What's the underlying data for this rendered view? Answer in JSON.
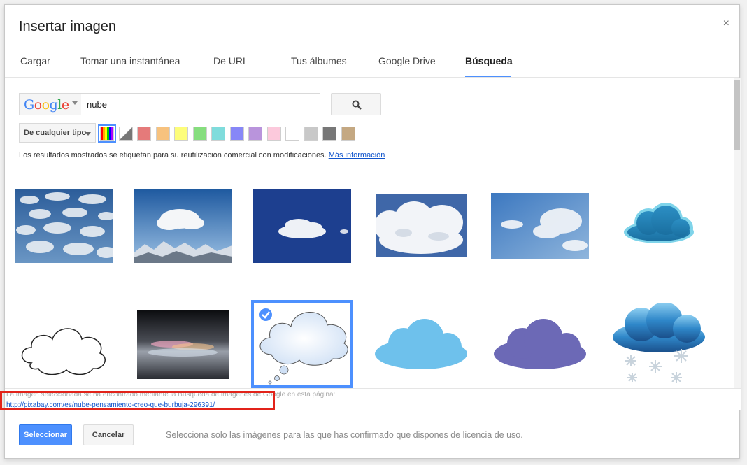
{
  "dialog": {
    "title": "Insertar imagen",
    "close_symbol": "×"
  },
  "tabs": [
    {
      "label": "Cargar",
      "active": false
    },
    {
      "label": "Tomar una instantánea",
      "active": false
    },
    {
      "label": "De URL",
      "active": false
    },
    {
      "label": "Tus álbumes",
      "active": false
    },
    {
      "label": "Google Drive",
      "active": false
    },
    {
      "label": "Búsqueda",
      "active": true
    }
  ],
  "search": {
    "engine_label": "Google",
    "query": "nube",
    "button_icon": "search-icon"
  },
  "filters": {
    "type_label": "De cualquier tipo",
    "colors": [
      "multicolor",
      "transparent",
      "#e57a7a",
      "#f7c27e",
      "#fdfd7a",
      "#86de7e",
      "#7fdcdc",
      "#8787f7",
      "#b994dc",
      "#fcc9dc",
      "#ffffff",
      "#c8c8c8",
      "#777777",
      "#c4a882"
    ],
    "selected_color_index": 0
  },
  "license": {
    "text": "Los resultados mostrados se etiquetan para su reutilización comercial con modificaciones.",
    "link": "Más información"
  },
  "results": {
    "selected_index": 8
  },
  "source": {
    "caption": "La imagen seleccionada se ha encontrado mediante la Búsqueda de imágenes de Google en esta página:",
    "url": "http://pixabay.com/es/nube-pensamiento-creo-que-burbuja-296391/"
  },
  "footer": {
    "select_label": "Seleccionar",
    "cancel_label": "Cancelar",
    "note": "Selecciona solo las imágenes para las que has confirmado que dispones de licencia de uso."
  },
  "colors": {
    "accent": "#4d90fe",
    "link": "#1155cc",
    "highlight": "#e2231a"
  }
}
